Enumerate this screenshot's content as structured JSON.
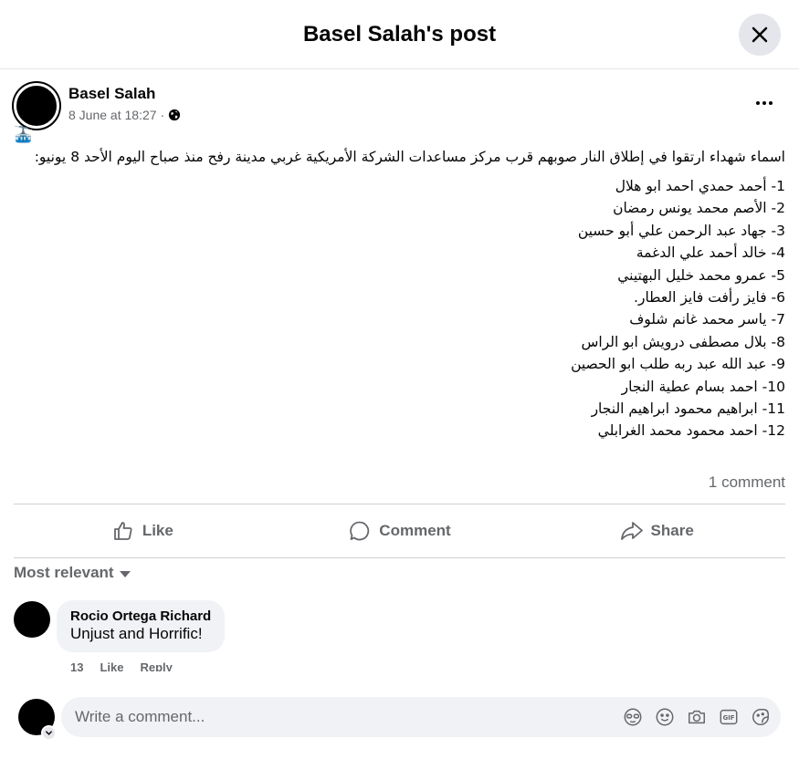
{
  "header": {
    "title": "Basel Salah's post"
  },
  "post": {
    "author": "Basel Salah",
    "timestamp": "8 June at 18:27",
    "meta_separator": "·",
    "avatar_emoji": "🚠",
    "intro": "اسماء شهداء ارتقوا في إطلاق النار صوبهم قرب مركز مساعدات الشركة الأمريكية غربي مدينة رفح منذ صباح اليوم الأحد 8 يونيو:",
    "names": [
      "1- أحمد حمدي احمد ابو هلال",
      "2- الأصم  محمد يونس رمضان",
      "3- جهاد عبد الرحمن علي أبو حسين",
      "4-  خالد أحمد علي الدغمة",
      "5- عمرو محمد خليل البهتيني",
      "6- فايز رأفت فايز العطار.",
      "7- ياسر محمد غانم شلوف",
      "8- بلال مصطفى درويش ابو الراس",
      "9- عبد الله عبد ربه طلب ابو الحصين",
      "10- احمد بسام عطية النجار",
      "11- ابراهيم محمود ابراهيم النجار",
      "12- احمد محمود محمد الغرابلي"
    ],
    "comments_count": "1 comment"
  },
  "actions": {
    "like": "Like",
    "comment": "Comment",
    "share": "Share"
  },
  "sort": {
    "label": "Most relevant"
  },
  "comment": {
    "author": "Rocio Ortega Richard",
    "text": "Unjust and Horrific!",
    "time": "13",
    "like": "Like",
    "reply": "Reply"
  },
  "compose": {
    "placeholder": "Write a comment..."
  },
  "icons": {
    "close": "close-icon",
    "globe": "globe-icon",
    "more": "more-horizontal-icon",
    "like": "thumbs-up-icon",
    "comment": "speech-bubble-icon",
    "share": "share-arrow-icon",
    "avatar_sticker": "avatar-sticker-icon",
    "emoji": "emoji-icon",
    "camera": "camera-icon",
    "gif": "gif-icon",
    "sticker": "sticker-icon"
  }
}
